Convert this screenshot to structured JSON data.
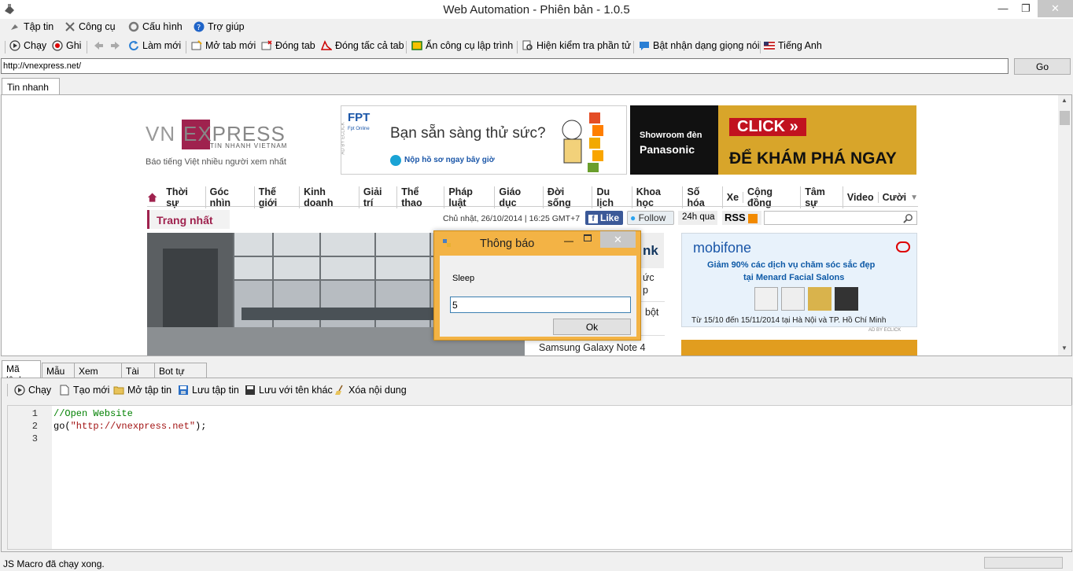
{
  "window": {
    "title": "Web Automation - Phiên bản - 1.0.5",
    "minimize": "—",
    "maximize": "❐",
    "close": "✕"
  },
  "menu": [
    "Tập tin",
    "Công cụ",
    "Cấu hình",
    "Trợ giúp"
  ],
  "toolbar": {
    "run": "Chạy",
    "record": "Ghi",
    "refresh": "Làm mới",
    "new_tab": "Mở tab mới",
    "close_tab": "Đóng tab",
    "close_all_tabs": "Đóng tấc cả tab",
    "hide_dev_tools": "Ẩn công cụ lập trình",
    "show_inspector": "Hiện kiểm tra phần tử",
    "voice": "Bật nhận dạng giọng nói",
    "language": "Tiếng Anh"
  },
  "urlbar": {
    "url": "http://vnexpress.net/",
    "go": "Go"
  },
  "browser_tab": "Tin nhanh ...",
  "page": {
    "logo_vn": "VN",
    "logo_express": "EXPRESS",
    "logo_sub": "TIN NHANH VIETNAM",
    "tagline": "Báo tiếng Việt nhiều người xem nhất",
    "ad_fpt_brand": "FPT",
    "ad_fpt_sub": "Fpt Online",
    "ad_fpt_title": "Bạn sẵn sàng thử sức?",
    "ad_fpt_cta": "Nộp hồ sơ ngay bây giờ",
    "ad_by": "AD BY ECLICK",
    "ad_pana_1": "Showroom đèn",
    "ad_pana_2": "Panasonic",
    "ad_pana_click": "CLICK »",
    "ad_pana_cta": "ĐỂ KHÁM PHÁ NGAY",
    "nav": [
      "Thời sự",
      "Góc nhìn",
      "Thế giới",
      "Kinh doanh",
      "Giải trí",
      "Thể thao",
      "Pháp luật",
      "Giáo dục",
      "Đời sống",
      "Du lịch",
      "Khoa học",
      "Số hóa",
      "Xe",
      "Cộng đồng",
      "Tâm sự",
      "Video",
      "Cười"
    ],
    "section": "Trang nhất",
    "date": "Chủ nhật, 26/10/2014 | 16:25 GMT+7",
    "fb_like": "Like",
    "tw_follow": "Follow",
    "h24": "24h qua",
    "rss": "RSS",
    "news_1": "nk",
    "news_2": "ức",
    "news_3": "p",
    "news_4": "bột",
    "news_5": "Samsung Galaxy Note 4",
    "mobi_brand": "mobifone",
    "mobi_line1": "Giảm 90% các dịch vụ chăm sóc sắc đẹp",
    "mobi_line2": "tại Menard Facial Salons",
    "mobi_date": "Từ 15/10 đến 15/11/2014 tại Hà Nội và TP. Hồ Chí Minh"
  },
  "dialog": {
    "title": "Thông báo",
    "label": "Sleep",
    "value": "5",
    "ok": "Ok"
  },
  "bottom_tabs": [
    "Mã lệnh",
    "Mẫu",
    "Xem trước",
    "Tài về",
    "Bot tự động"
  ],
  "editor_toolbar": {
    "run": "Chạy",
    "new": "Tạo mới",
    "open": "Mở tập tin",
    "save": "Lưu tập tin",
    "save_as": "Lưu với tên khác",
    "clear": "Xóa nội dung"
  },
  "code": {
    "line_numbers": [
      "1",
      "2",
      "3"
    ],
    "line1": "//Open Website",
    "line2_a": "go(",
    "line2_str": "\"http://vnexpress.net\"",
    "line2_b": ");"
  },
  "status": "JS Macro đã chạy xong.",
  "colors": {
    "vn_red": "#9f224e",
    "close_red": "#c7c7c7",
    "dialog_border": "#f3b345",
    "link_blue": "#3b5998"
  }
}
